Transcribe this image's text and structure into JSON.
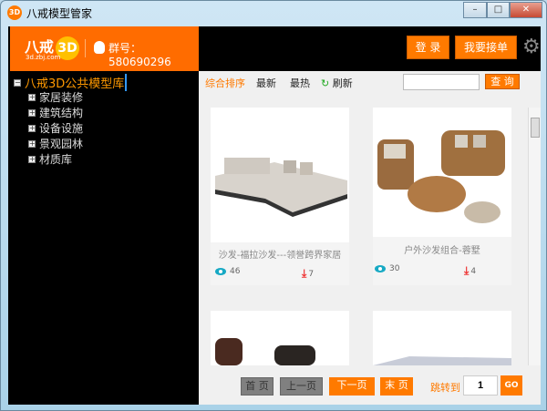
{
  "window": {
    "title": "八戒模型管家",
    "icon": "3D",
    "controls": [
      "minimize",
      "maximize",
      "close"
    ]
  },
  "header": {
    "logo_text": "八戒",
    "logo_badge": "3D",
    "logo_sub": "3d.zbj.com",
    "group_label": "群号：580690296",
    "login": "登 录",
    "take_order": "我要接单",
    "settings_icon": "gear-icon"
  },
  "tree": {
    "root": "八戒3D公共模型库",
    "children": [
      "家居装修",
      "建筑结构",
      "设备设施",
      "景观园林",
      "材质库"
    ]
  },
  "toolbar": {
    "sort_all": "综合排序",
    "newest": "最新",
    "hottest": "最热",
    "refresh": "刷新",
    "search_value": "",
    "search_button": "查 询",
    "accent": "#ff7a00"
  },
  "cards": [
    {
      "name": "沙发-福拉沙发---领誉跨界家居",
      "views": "46",
      "downloads": "7"
    },
    {
      "name": "户外沙发组合-蓉墅",
      "views": "30",
      "downloads": "4"
    },
    {
      "name": "",
      "views": "",
      "downloads": ""
    },
    {
      "name": "",
      "views": "",
      "downloads": ""
    }
  ],
  "pagination": {
    "first": "首 页",
    "prev": "上一页",
    "next": "下一页",
    "last": "末 页",
    "jump_label": "跳转到",
    "page_value": "1",
    "go": "GO"
  }
}
